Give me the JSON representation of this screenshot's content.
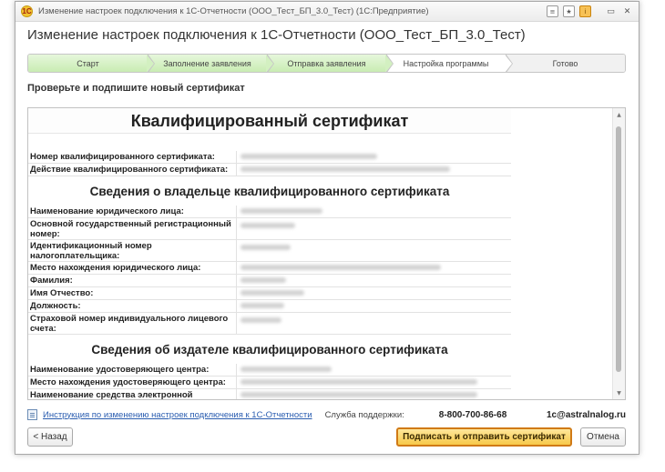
{
  "window": {
    "title": "Изменение настроек подключения к 1С-Отчетности (ООО_Тест_БП_3.0_Тест) (1С:Предприятие)",
    "app_icon": "1С"
  },
  "form": {
    "title": "Изменение настроек подключения к 1С-Отчетности (ООО_Тест_БП_3.0_Тест)",
    "subtitle": "Проверьте и подпишите новый сертификат"
  },
  "steps": [
    {
      "label": "Старт",
      "state": "done"
    },
    {
      "label": "Заполнение заявления",
      "state": "done"
    },
    {
      "label": "Отправка заявления",
      "state": "done"
    },
    {
      "label": "Настройка программы",
      "state": "current"
    },
    {
      "label": "Готово",
      "state": "todo"
    }
  ],
  "certificate": {
    "title": "Квалифицированный сертификат",
    "section_owner": "Сведения о владельце квалифицированного сертификата",
    "section_issuer": "Сведения об издателе квалифицированного сертификата",
    "rows_top": [
      "Номер квалифицированного сертификата:",
      "Действие квалифицированного сертификата:"
    ],
    "rows_owner": [
      "Наименование юридического лица:",
      "Основной государственный регистрационный номер:",
      "Идентификационный номер налогоплательщика:",
      "Место нахождения юридического лица:",
      "Фамилия:",
      "Имя Отчество:",
      "Должность:",
      "Страховой номер индивидуального лицевого счета:"
    ],
    "rows_issuer": [
      "Наименование удостоверяющего центра:",
      "Место нахождения удостоверяющего центра:",
      "Наименование средства электронной"
    ]
  },
  "footer": {
    "instruction_link": "Инструкция по изменению настроек подключения к 1С-Отчетности",
    "support_label": "Служба поддержки:",
    "support_phone": "8-800-700-86-68",
    "support_email": "1c@astralnalog.ru"
  },
  "buttons": {
    "back": "< Назад",
    "sign": "Подписать и отправить сертификат",
    "cancel": "Отмена"
  },
  "colors": {
    "done_step": "#d3f0c1",
    "accent_border": "#d07a16",
    "link": "#2a5db0"
  }
}
